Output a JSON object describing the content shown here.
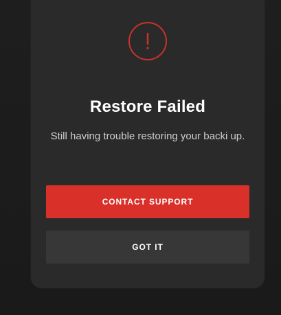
{
  "dialog": {
    "icon": "exclamation-circle-icon",
    "title": "Restore Failed",
    "message": "Still having trouble restoring your backi up.",
    "buttons": {
      "primary_label": "CONTACT SUPPORT",
      "secondary_label": "GOT IT"
    }
  },
  "colors": {
    "background": "#1b1b1b",
    "dialog_background": "#2a2a2a",
    "accent_red": "#d9312a",
    "secondary_button": "#373737"
  }
}
